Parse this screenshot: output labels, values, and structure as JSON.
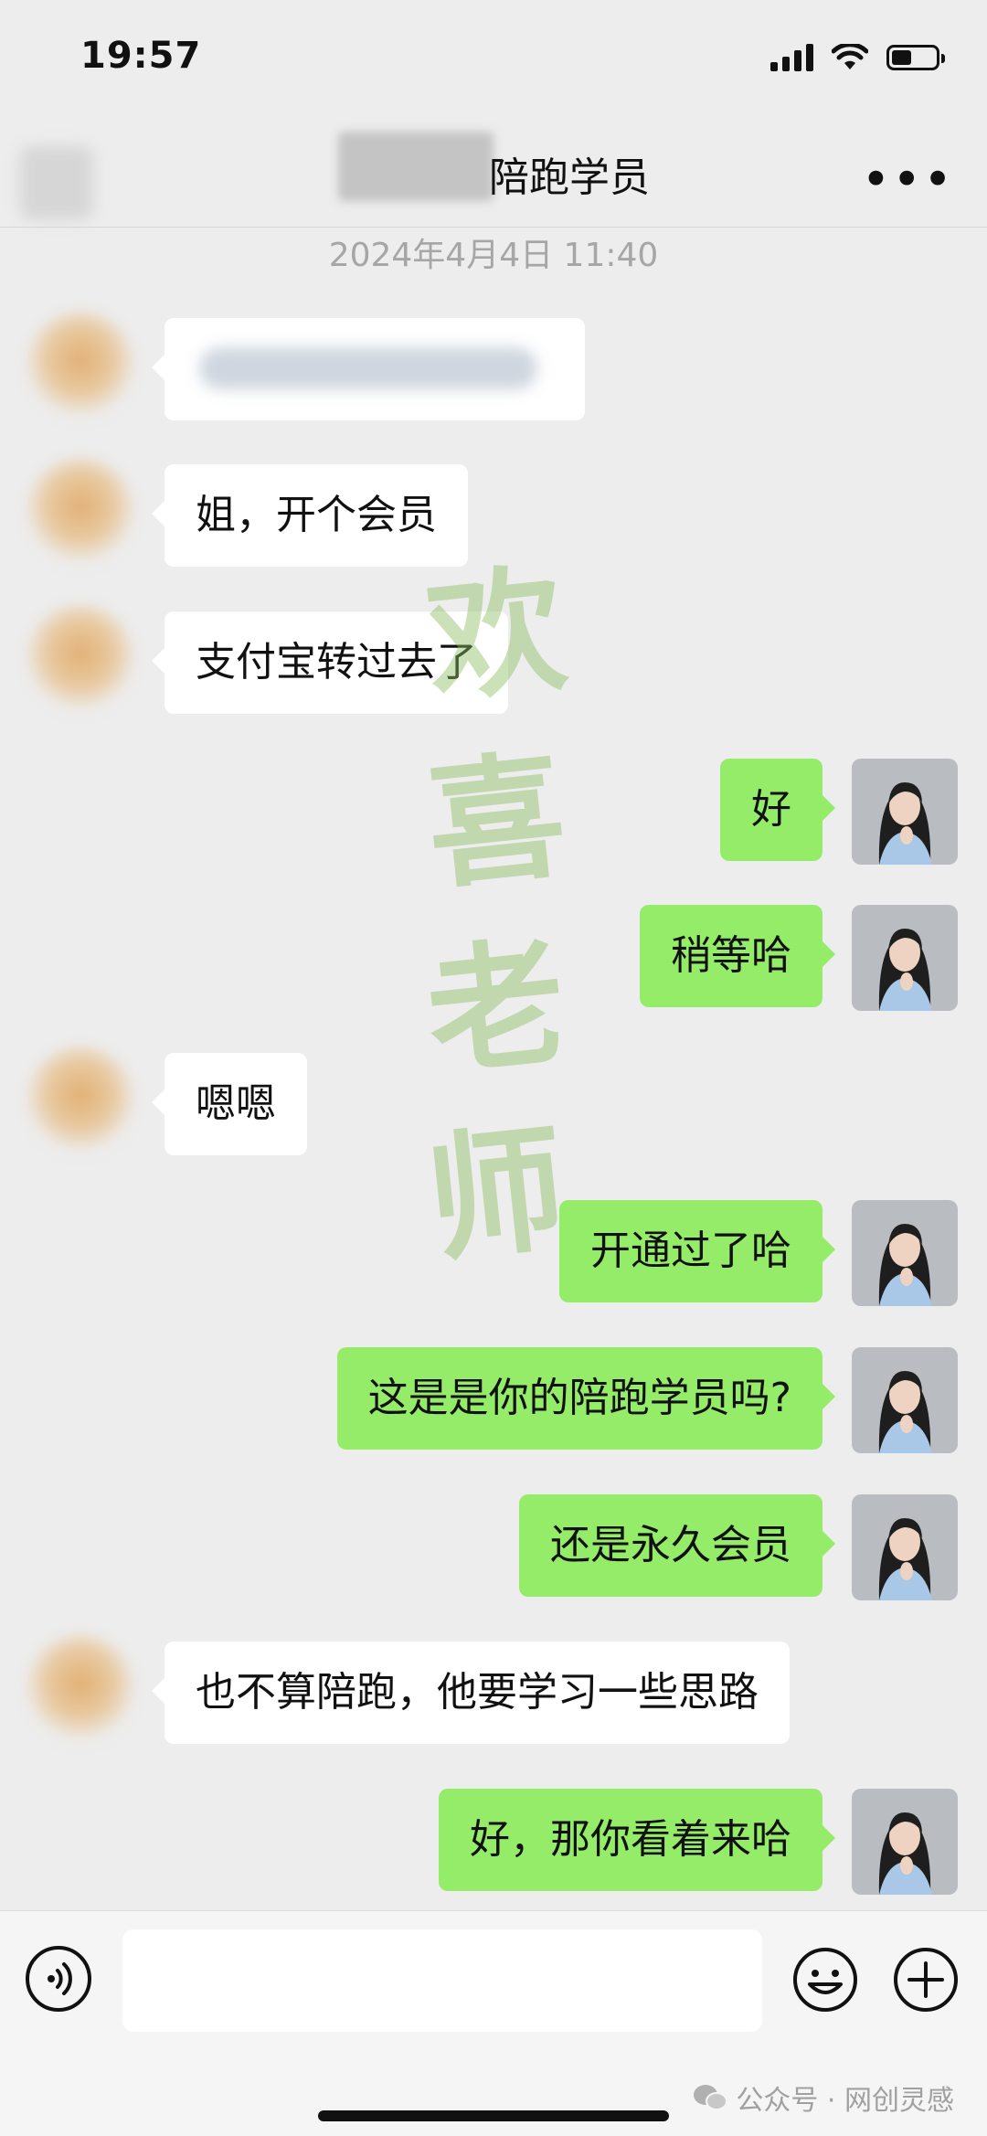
{
  "status_bar": {
    "time": "19:57",
    "battery_level": 0.45
  },
  "header": {
    "title_suffix": "陪跑学员",
    "more_icon": "more-dots-icon"
  },
  "chat": {
    "timestamp": "2024年4月4日 11:40",
    "messages": [
      {
        "side": "in",
        "text": ""
      },
      {
        "side": "in",
        "text": "姐，开个会员"
      },
      {
        "side": "in",
        "text": "支付宝转过去了"
      },
      {
        "side": "out",
        "text": "好"
      },
      {
        "side": "out",
        "text": "稍等哈"
      },
      {
        "side": "in",
        "text": "嗯嗯"
      },
      {
        "side": "out",
        "text": "开通过了哈"
      },
      {
        "side": "out",
        "text": "这是是你的陪跑学员吗?"
      },
      {
        "side": "out",
        "text": "还是永久会员"
      },
      {
        "side": "in",
        "text": "也不算陪跑，他要学习一些思路"
      },
      {
        "side": "out",
        "text": "好，那你看着来哈"
      }
    ]
  },
  "watermark": {
    "chars": [
      "欢",
      "喜",
      "老",
      "师"
    ]
  },
  "input_bar": {
    "voice_icon": "voice-icon",
    "emoji_icon": "emoji-icon",
    "plus_icon": "plus-icon"
  },
  "footer": {
    "text": "公众号 · 网创灵感"
  },
  "colors": {
    "incoming_bubble": "#ffffff",
    "outgoing_bubble": "#95ec69",
    "background": "#ededed"
  }
}
